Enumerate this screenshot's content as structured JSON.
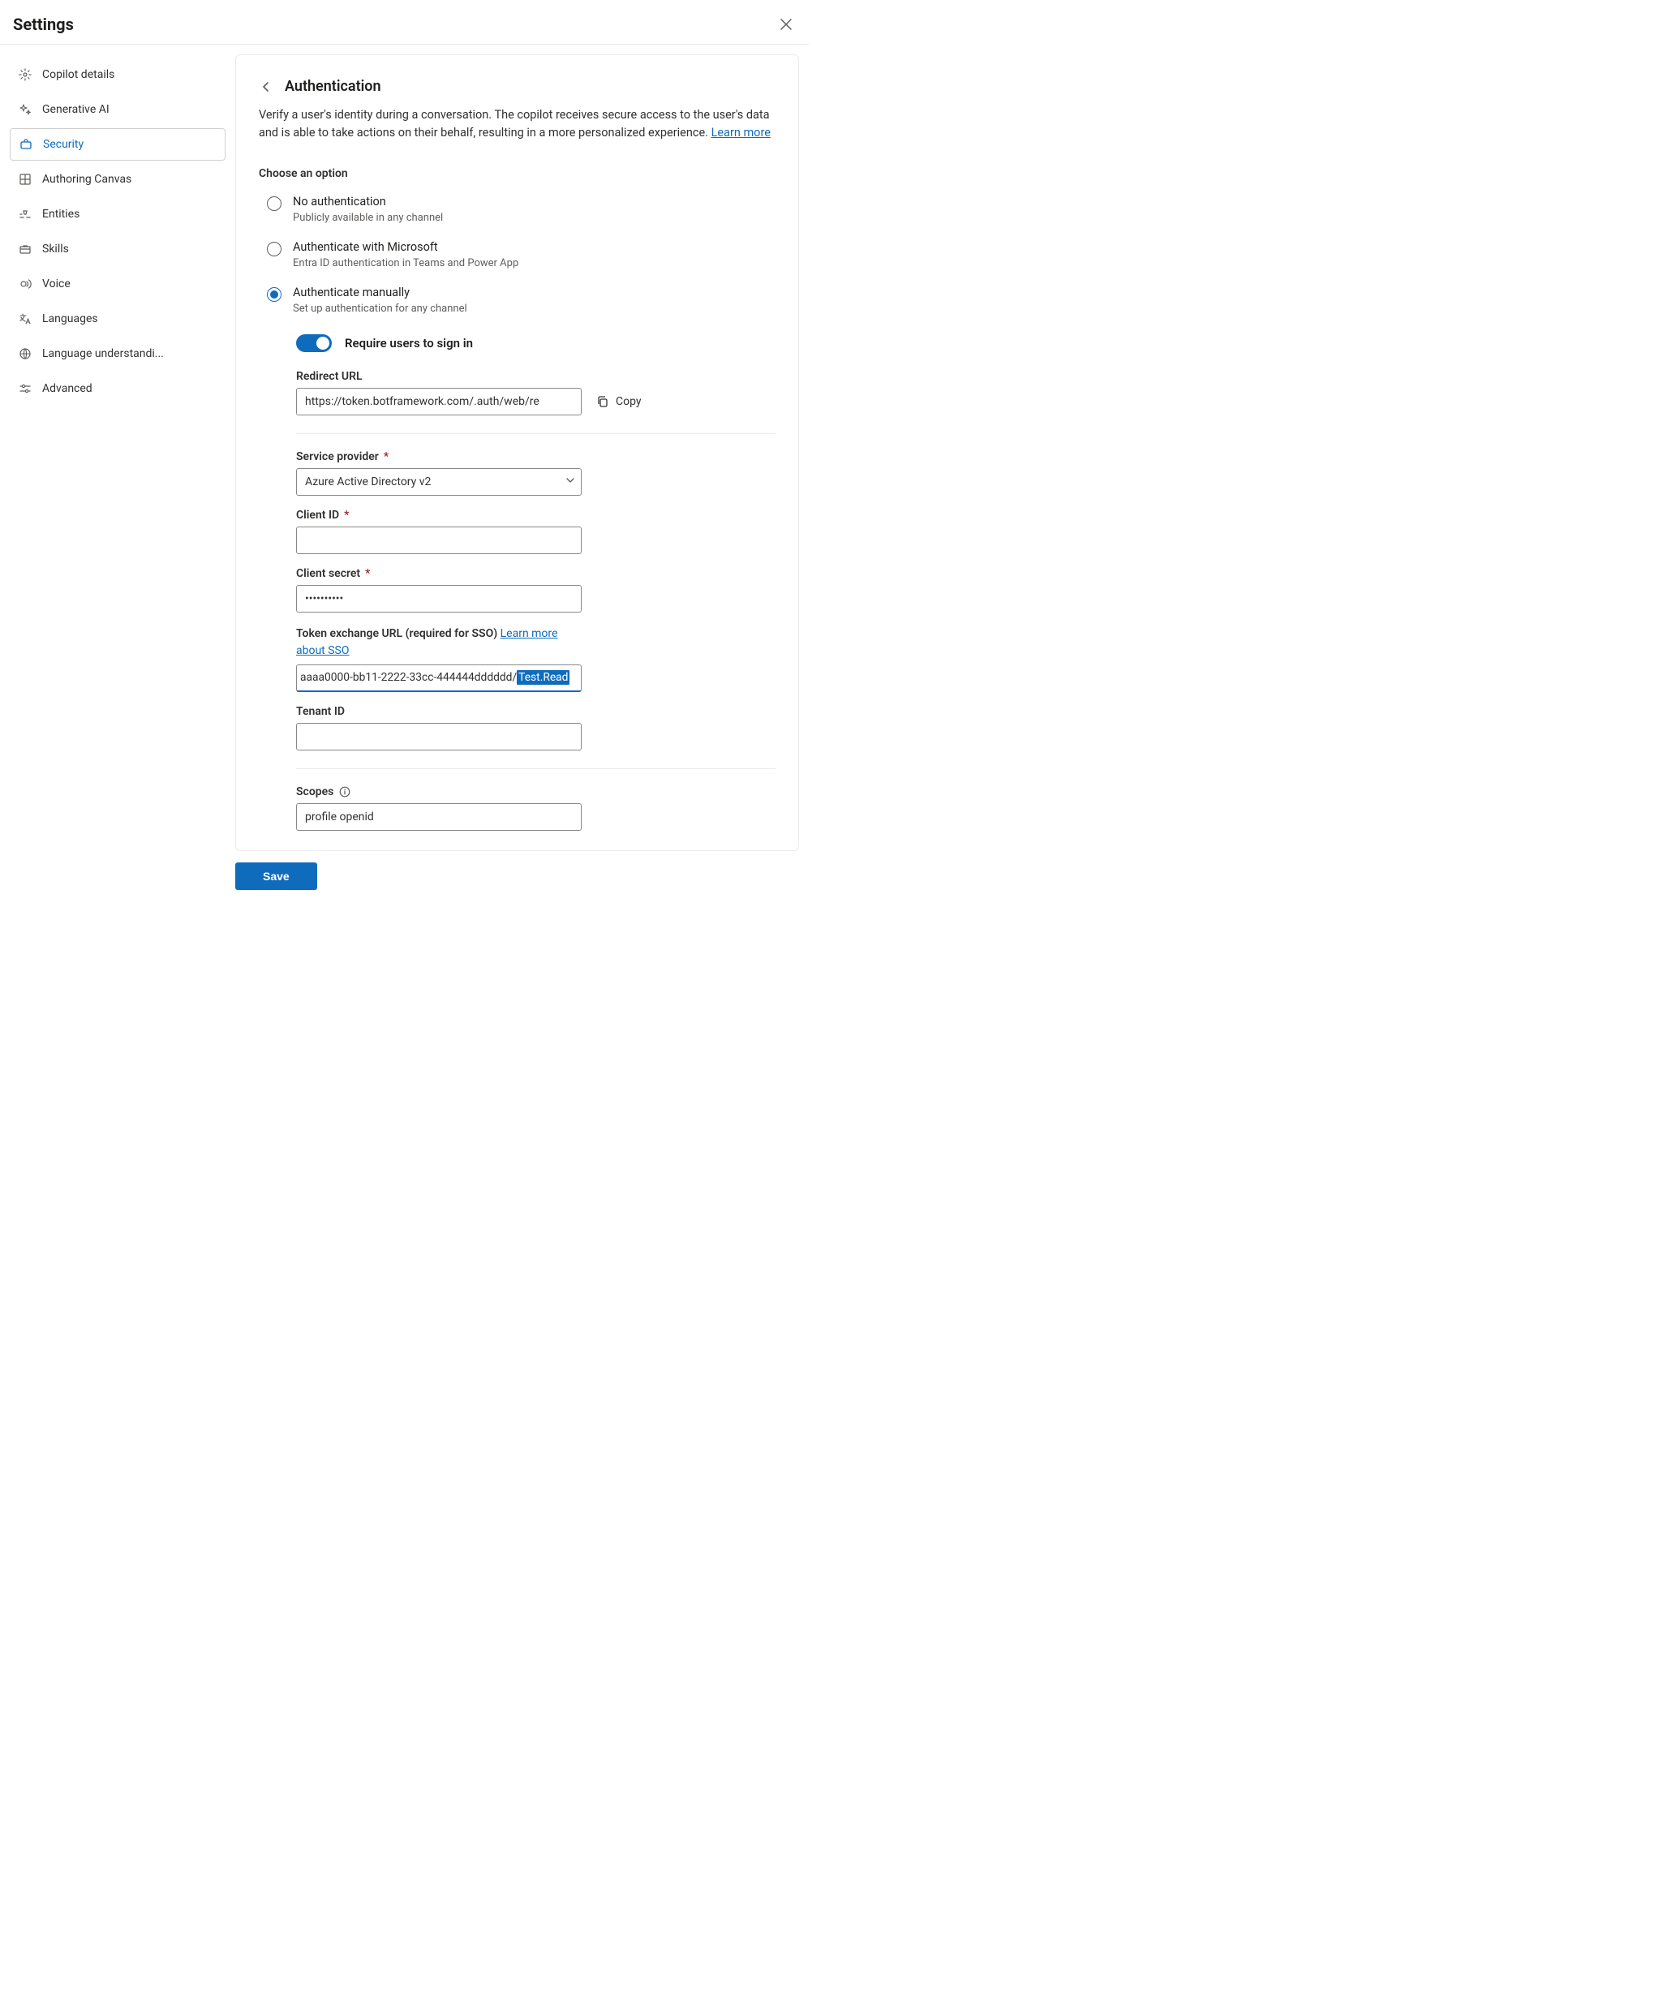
{
  "header": {
    "title": "Settings"
  },
  "sidebar": {
    "items": [
      {
        "label": "Copilot details"
      },
      {
        "label": "Generative AI"
      },
      {
        "label": "Security"
      },
      {
        "label": "Authoring Canvas"
      },
      {
        "label": "Entities"
      },
      {
        "label": "Skills"
      },
      {
        "label": "Voice"
      },
      {
        "label": "Languages"
      },
      {
        "label": "Language understandi..."
      },
      {
        "label": "Advanced"
      }
    ]
  },
  "main": {
    "title": "Authentication",
    "description_pre": "Verify a user's identity during a conversation. The copilot receives secure access to the user's data and is able to take actions on their behalf, resulting in a more personalized experience. ",
    "learn_more": "Learn more",
    "choose_label": "Choose an option",
    "options": [
      {
        "title": "No authentication",
        "sub": "Publicly available in any channel"
      },
      {
        "title": "Authenticate with Microsoft",
        "sub": "Entra ID authentication in Teams and Power App"
      },
      {
        "title": "Authenticate manually",
        "sub": "Set up authentication for any channel"
      }
    ],
    "toggle_label": "Require users to sign in",
    "redirect": {
      "label": "Redirect URL",
      "value": "https://token.botframework.com/.auth/web/re",
      "copy_label": "Copy"
    },
    "service_provider": {
      "label": "Service provider",
      "value": "Azure Active Directory v2"
    },
    "client_id": {
      "label": "Client ID",
      "value": ""
    },
    "client_secret": {
      "label": "Client secret",
      "value": "••••••••••"
    },
    "token_exchange": {
      "label_a": "Token exchange URL (required for SSO) ",
      "link": "Learn more about SSO",
      "value_plain": "aaaa0000-bb11-2222-33cc-444444dddddd/",
      "value_highlight": "Test.Read"
    },
    "tenant_id": {
      "label": "Tenant ID",
      "value": ""
    },
    "scopes": {
      "label": "Scopes",
      "value": "profile openid"
    },
    "save_label": "Save"
  }
}
